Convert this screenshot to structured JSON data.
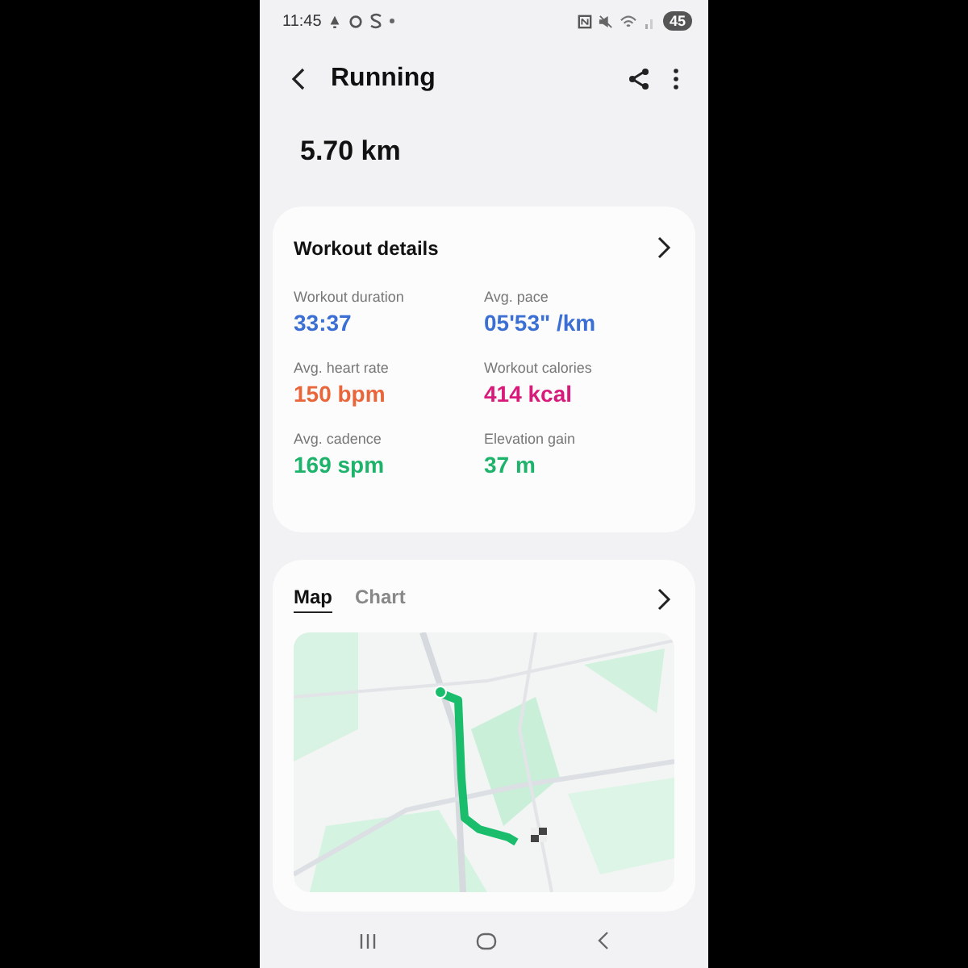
{
  "status_bar": {
    "time": "11:45",
    "battery": "45"
  },
  "header": {
    "title": "Running"
  },
  "distance": "5.70 km",
  "workout_details": {
    "title": "Workout details",
    "metrics": [
      {
        "label": "Workout duration",
        "value": "33:37",
        "color": "#3b6fd4"
      },
      {
        "label": "Avg. pace",
        "value": "05'53\" /km",
        "color": "#3b6fd4"
      },
      {
        "label": "Avg. heart rate",
        "value": "150 bpm",
        "color": "#e8663a"
      },
      {
        "label": "Workout calories",
        "value": "414 kcal",
        "color": "#d81b7a"
      },
      {
        "label": "Avg. cadence",
        "value": "169 spm",
        "color": "#1db36a"
      },
      {
        "label": "Elevation gain",
        "value": "37 m",
        "color": "#1db36a"
      }
    ]
  },
  "map_card": {
    "tabs": [
      {
        "label": "Map",
        "selected": true
      },
      {
        "label": "Chart",
        "selected": false
      }
    ]
  }
}
